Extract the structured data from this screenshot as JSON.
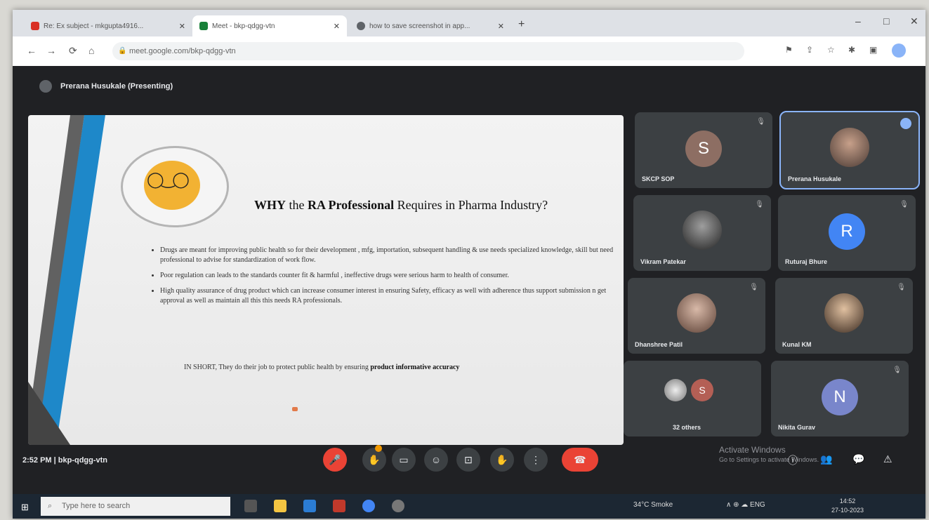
{
  "browser": {
    "tabs": [
      {
        "label": "Re: Ex subject - mkgupta4916...",
        "color": "#d93025"
      },
      {
        "label": "Meet - bkp-qdgg-vtn",
        "color": "#188038"
      },
      {
        "label": "how to save screenshot in app...",
        "color": "#5f6368"
      }
    ],
    "new_tab": "+",
    "window_controls": [
      "–",
      "□",
      "✕"
    ],
    "nav": [
      "←",
      "→",
      "⟳",
      "⌂"
    ],
    "url": "meet.google.com/bkp-qdgg-vtn"
  },
  "meet": {
    "presenter_label": "Prerana Husukale (Presenting)",
    "slide": {
      "title_why": "WHY",
      "title_the": " the ",
      "title_ra": "RA Professional",
      "title_rest": " Requires in Pharma Industry?",
      "bullets": [
        "Drugs are meant for improving public health so for their development , mfg, importation, subsequent handling & use needs specialized knowledge, skill but need professional to advise for standardization of work flow.",
        "Poor regulation can leads to the standards counter fit & harmful , ineffective drugs were serious harm to health of consumer.",
        "High quality assurance of drug product which can increase consumer interest in ensuring Safety, efficacy as well with adherence thus support submission n get approval as well as maintain all this this needs RA professionals."
      ],
      "summary_lead": "IN SHORT, They do their job to protect public health by ensuring ",
      "summary_bold": "product informative accuracy"
    },
    "participants": [
      {
        "name": "SKCP SOP",
        "initial": "S",
        "color": "#8d6e63"
      },
      {
        "name": "Prerana Husukale",
        "initial": "",
        "color": ""
      },
      {
        "name": "Vikram Patekar",
        "initial": "",
        "color": ""
      },
      {
        "name": "Ruturaj Bhure",
        "initial": "R",
        "color": "#4285f4"
      },
      {
        "name": "Dhanshree Patil",
        "initial": "",
        "color": ""
      },
      {
        "name": "Kunal KM",
        "initial": "",
        "color": ""
      },
      {
        "name": "32 others",
        "initial": "S",
        "color": "#b45f55"
      },
      {
        "name": "Nikita Gurav",
        "initial": "N",
        "color": "#7986cb"
      }
    ],
    "time_and_code": "2:52 PM  |  bkp-qdgg-vtn",
    "controls": [
      "🎤",
      "✋",
      "▭",
      "☺",
      "⊡",
      "✋",
      "⋮",
      "☎"
    ],
    "activate_title": "Activate Windows",
    "activate_sub": "Go to Settings to activate Windows.",
    "right_controls": [
      "ⓘ",
      "👥",
      "💬",
      "⚠"
    ]
  },
  "taskbar": {
    "start": "⊞",
    "search_placeholder": "Type here to search",
    "weather": "34°C  Smoke",
    "tray": "∧  ⊕  ☁  ENG",
    "clock_time": "14:52",
    "clock_date": "27-10-2023"
  }
}
